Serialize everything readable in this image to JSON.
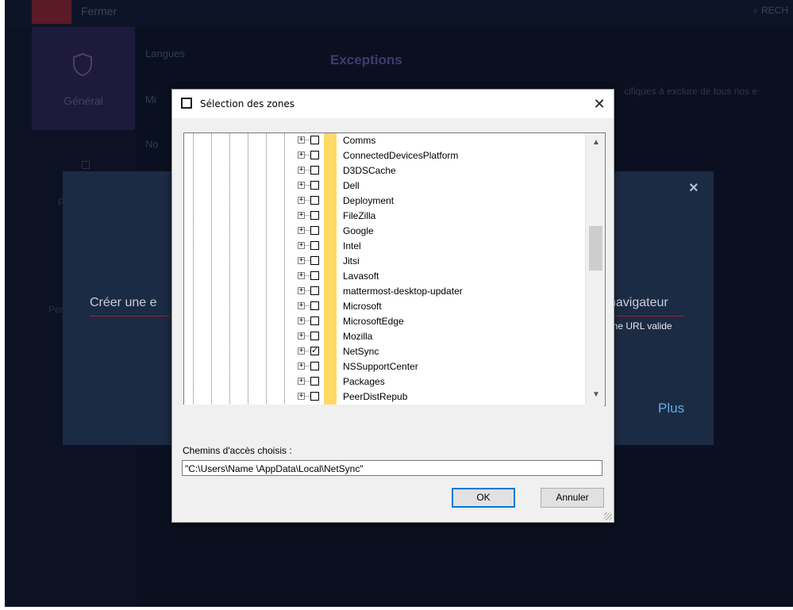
{
  "app": {
    "title": "Fermer",
    "search": "RECH",
    "nav": {
      "general_label": "Général"
    },
    "submenu": [
      "Langues",
      "Mi",
      "No"
    ],
    "exceptions_title": "Exceptions",
    "exceptions_desc": "cifiques à exclure de tous nos e",
    "left_fragments": [
      "Pr",
      "Per"
    ]
  },
  "modal": {
    "create_left": "Créer une e",
    "nav_right": "navigateur",
    "url_text": "une URL valide",
    "plus": "Plus",
    "close": "×"
  },
  "dialog": {
    "title": "Sélection des zones",
    "close": "✕",
    "items": [
      {
        "label": "Comms",
        "checked": false
      },
      {
        "label": "ConnectedDevicesPlatform",
        "checked": false
      },
      {
        "label": "D3DSCache",
        "checked": false
      },
      {
        "label": "Dell",
        "checked": false
      },
      {
        "label": "Deployment",
        "checked": false
      },
      {
        "label": "FileZilla",
        "checked": false
      },
      {
        "label": "Google",
        "checked": false
      },
      {
        "label": "Intel",
        "checked": false
      },
      {
        "label": "Jitsi",
        "checked": false
      },
      {
        "label": "Lavasoft",
        "checked": false
      },
      {
        "label": "mattermost-desktop-updater",
        "checked": false
      },
      {
        "label": "Microsoft",
        "checked": false
      },
      {
        "label": "MicrosoftEdge",
        "checked": false
      },
      {
        "label": "Mozilla",
        "checked": false
      },
      {
        "label": "NetSync",
        "checked": true
      },
      {
        "label": "NSSupportCenter",
        "checked": false
      },
      {
        "label": "Packages",
        "checked": false
      },
      {
        "label": "PeerDistRepub",
        "checked": false
      }
    ],
    "path_label": "Chemins d'accès choisis :",
    "path_value": "\"C:\\Users\\Name  \\AppData\\Local\\NetSync\"",
    "ok_label": "OK",
    "cancel_label": "Annuler",
    "scroll_up_icon": "chevron-up-icon",
    "scroll_down_icon": "chevron-down-icon"
  }
}
